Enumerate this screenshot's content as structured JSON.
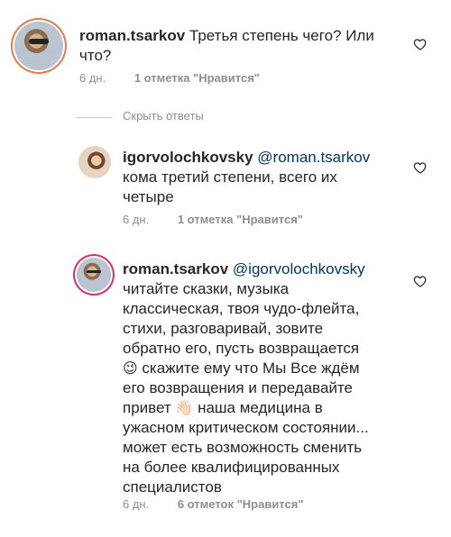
{
  "comments": [
    {
      "username": "roman.tsarkov",
      "mention": "",
      "text": "Третья степень чего? Или что?",
      "lines": [
        "Третья степень чего? Или",
        "что?"
      ],
      "age": "6 дн.",
      "likes": "1 отметка \"Нравится\""
    },
    {
      "username": "igorvolochkovsky",
      "mention": "@roman.tsarkov",
      "lines": [
        "кома третий степени, всего их",
        "четыре"
      ],
      "age": "6 дн.",
      "likes": "1 отметка \"Нравится\""
    },
    {
      "username": "roman.tsarkov",
      "mention": "@igorvolochkovsky",
      "lines": [
        "читайте сказки, музыка",
        "классическая, твоя чудо-флейта,",
        "стихи, разговаривай, зовите",
        "обратно его, пусть возвращается",
        "скажите ему что Мы Все ждём",
        "его возвращения и передавайте",
        "привет",
        "наша медицина в",
        "ужасном критическом состоянии...",
        "может есть возможность сменить",
        "на более квалифицированных",
        "специалистов"
      ],
      "age": "6 дн.",
      "likes": "6 отметок \"Нравится\""
    }
  ],
  "hide_replies": "Скрыть ответы",
  "icons": {
    "heart": "heart-outline-icon",
    "wink_emoji": "😉",
    "wave_emoji": "👋🏻"
  },
  "colors": {
    "text": "#262626",
    "secondary": "#8e8e8e",
    "mention": "#00376b"
  }
}
